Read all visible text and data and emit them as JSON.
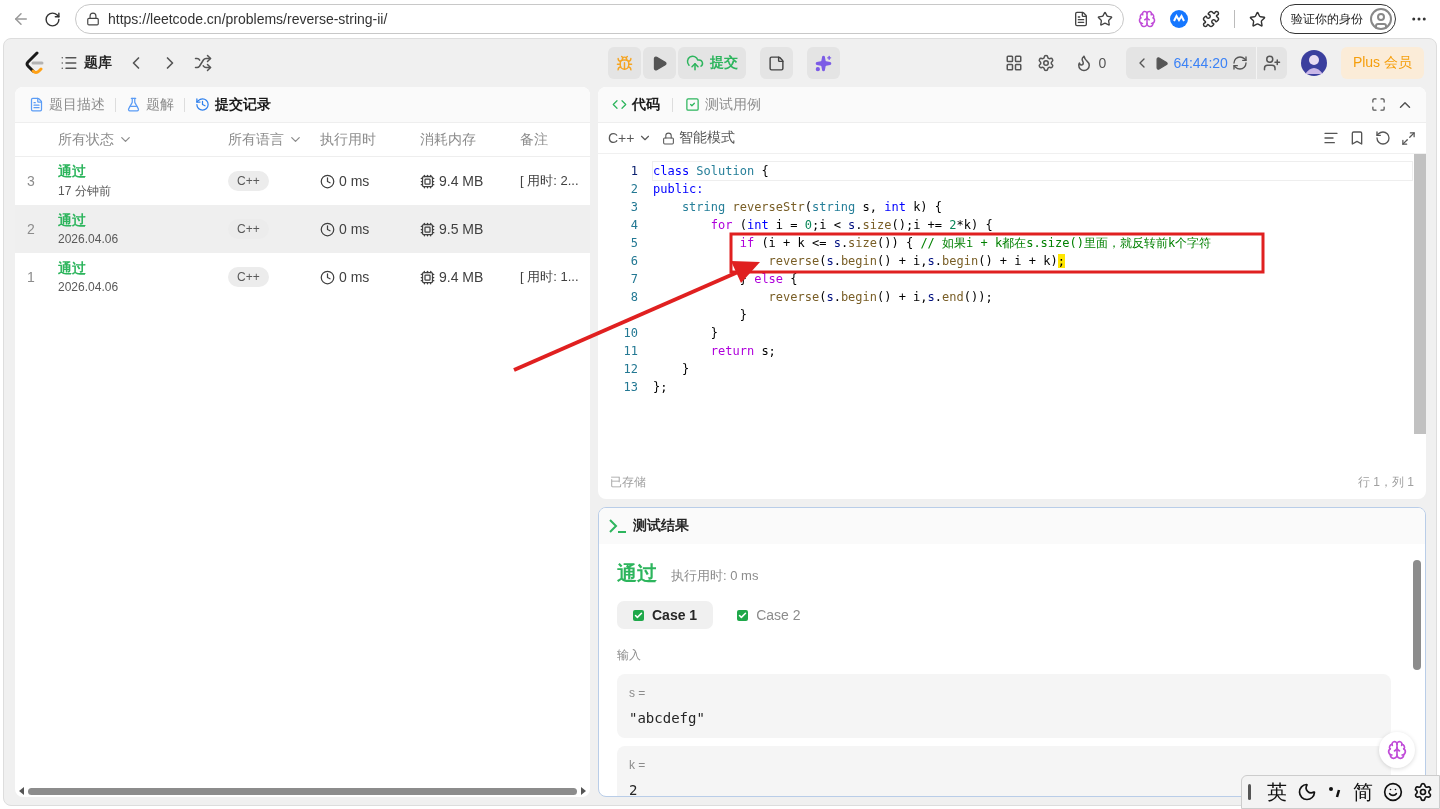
{
  "browser": {
    "url": "https://leetcode.cn/problems/reverse-string-ii/",
    "profile_label": "验证你的身份"
  },
  "nav": {
    "problem_bank": "题库",
    "submit": "提交",
    "streak": "0",
    "timer": "64:44:20",
    "plus": "Plus 会员"
  },
  "left_tabs": [
    {
      "label": "题目描述",
      "selected": false,
      "kind": "description"
    },
    {
      "label": "题解",
      "selected": false,
      "kind": "solutions"
    },
    {
      "label": "提交记录",
      "selected": true,
      "kind": "submissions"
    }
  ],
  "submissions": {
    "columns": [
      {
        "label": "所有状态",
        "dropdown": true
      },
      {
        "label": "所有语言",
        "dropdown": true
      },
      {
        "label": "执行用时",
        "dropdown": false
      },
      {
        "label": "消耗内存",
        "dropdown": false
      },
      {
        "label": "备注",
        "dropdown": false
      }
    ],
    "rows": [
      {
        "index": "3",
        "status": "通过",
        "time": "17 分钟前",
        "language": "C++",
        "runtime": "0 ms",
        "memory": "9.4 MB",
        "note": "[ 用时: 2...",
        "selected": false
      },
      {
        "index": "2",
        "status": "通过",
        "time": "2026.04.06",
        "language": "C++",
        "runtime": "0 ms",
        "memory": "9.5 MB",
        "selected": true
      },
      {
        "index": "1",
        "status": "通过",
        "time": "2026.04.06",
        "language": "C++",
        "runtime": "0 ms",
        "memory": "9.4 MB",
        "note": "[ 用时: 1...",
        "selected": false
      }
    ]
  },
  "editor": {
    "tabs": [
      {
        "label": "代码",
        "selected": true,
        "kind": "code"
      },
      {
        "label": "测试用例",
        "selected": false,
        "kind": "testcase"
      }
    ],
    "language": "C++",
    "mode": "智能模式",
    "lines": [
      {
        "number": "1",
        "tokens": [
          {
            "t": "class",
            "color": "#0000ff"
          },
          {
            "t": " Solution",
            "color": "#267f99"
          },
          {
            "t": " {"
          }
        ]
      },
      {
        "number": "2",
        "tokens": [
          {
            "t": "public:",
            "color": "#0000ff"
          }
        ]
      },
      {
        "number": "3",
        "tokens": [
          {
            "t": "    string",
            "color": "#267f99"
          },
          {
            "t": " reverseStr",
            "color": "#795e26"
          },
          {
            "t": "("
          },
          {
            "t": "string",
            "color": "#267f99"
          },
          {
            "t": " s, "
          },
          {
            "t": "int",
            "color": "#0000ff"
          },
          {
            "t": " k) {"
          }
        ]
      },
      {
        "number": "4",
        "tokens": [
          {
            "t": "        for",
            "color": "#af00db"
          },
          {
            "t": " ("
          },
          {
            "t": "int",
            "color": "#0000ff"
          },
          {
            "t": " i = "
          },
          {
            "t": "0",
            "color": "#098658"
          },
          {
            "t": ";i < "
          },
          {
            "t": "s",
            "color": "#001080"
          },
          {
            "t": "."
          },
          {
            "t": "size",
            "color": "#795e26"
          },
          {
            "t": "();i += "
          },
          {
            "t": "2",
            "color": "#098658"
          },
          {
            "t": "*k) {"
          }
        ]
      },
      {
        "number": "5",
        "tokens": [
          {
            "t": "            if",
            "color": "#af00db"
          },
          {
            "t": " (i + k <= "
          },
          {
            "t": "s",
            "color": "#001080"
          },
          {
            "t": "."
          },
          {
            "t": "size",
            "color": "#795e26"
          },
          {
            "t": "()) { "
          },
          {
            "t": "// 如果i + k都在s.size()里面，就反转前k个字符",
            "color": "#008000"
          }
        ]
      },
      {
        "number": "6",
        "tokens": [
          {
            "t": "                reverse",
            "color": "#795e26"
          },
          {
            "t": "("
          },
          {
            "t": "s",
            "color": "#001080"
          },
          {
            "t": "."
          },
          {
            "t": "begin",
            "color": "#795e26"
          },
          {
            "t": "() + i,"
          },
          {
            "t": "s",
            "color": "#001080"
          },
          {
            "t": "."
          },
          {
            "t": "begin",
            "color": "#795e26"
          },
          {
            "t": "() + i + k)"
          },
          {
            "t": ";",
            "highlighted": true
          }
        ]
      },
      {
        "number": "7",
        "tokens": [
          {
            "t": "            } "
          },
          {
            "t": "else",
            "color": "#af00db"
          },
          {
            "t": " {"
          }
        ]
      },
      {
        "number": "8",
        "tokens": [
          {
            "t": "                reverse",
            "color": "#795e26"
          },
          {
            "t": "("
          },
          {
            "t": "s",
            "color": "#001080"
          },
          {
            "t": "."
          },
          {
            "t": "begin",
            "color": "#795e26"
          },
          {
            "t": "() + i,"
          },
          {
            "t": "s",
            "color": "#001080"
          },
          {
            "t": "."
          },
          {
            "t": "end",
            "color": "#795e26"
          },
          {
            "t": "());"
          }
        ]
      },
      {
        "tokens": [
          {
            "t": "            }"
          }
        ]
      },
      {
        "number": "10",
        "tokens": [
          {
            "t": "        }"
          }
        ]
      },
      {
        "number": "11",
        "tokens": [
          {
            "t": "        return",
            "color": "#af00db"
          },
          {
            "t": " s;"
          }
        ]
      },
      {
        "number": "12",
        "tokens": [
          {
            "t": "    }"
          }
        ]
      },
      {
        "number": "13",
        "tokens": [
          {
            "t": "};"
          }
        ]
      }
    ],
    "saved": "已存储",
    "cursor": "行 1，列 1"
  },
  "result": {
    "title": "测试结果",
    "status": "通过",
    "runtime": "执行用时: 0 ms",
    "cases": [
      {
        "label": "Case 1",
        "selected": true,
        "passed": true
      },
      {
        "label": "Case 2",
        "selected": false,
        "passed": true
      }
    ],
    "input_label": "输入",
    "inputs": [
      {
        "name": "s =",
        "value": "\"abcdefg\""
      },
      {
        "name": "k =",
        "value": "2"
      }
    ]
  },
  "ime": {
    "lang": "英",
    "script": "简"
  }
}
